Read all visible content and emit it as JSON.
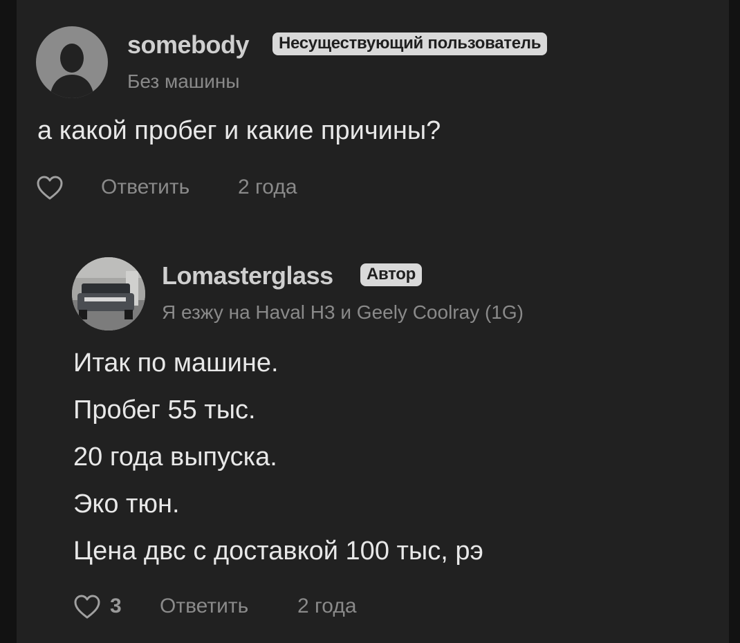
{
  "comments": [
    {
      "username": "somebody",
      "badge": "Несуществующий пользователь",
      "subline": "Без машины",
      "text": "а какой пробег и какие причины?",
      "actions": {
        "reply": "Ответить",
        "time": "2 года"
      }
    },
    {
      "username": "Lomasterglass",
      "badge": "Автор",
      "subline": "Я езжу на Haval H3 и Geely Coolray (1G)",
      "lines": [
        "Итак по машине.",
        "Пробег 55 тыс.",
        "20 года выпуска.",
        "Эко тюн.",
        "Цена двс с доставкой 100 тыс, рэ"
      ],
      "actions": {
        "likes": "3",
        "reply": "Ответить",
        "time": "2 года"
      }
    }
  ],
  "icons": {
    "like": "heart-outline-icon",
    "avatar_placeholder": "person-silhouette-icon"
  },
  "colors": {
    "background": "#212121",
    "badge": "#d9d9d9",
    "muted": "#8a8a8a",
    "text": "#e8e8e8"
  }
}
